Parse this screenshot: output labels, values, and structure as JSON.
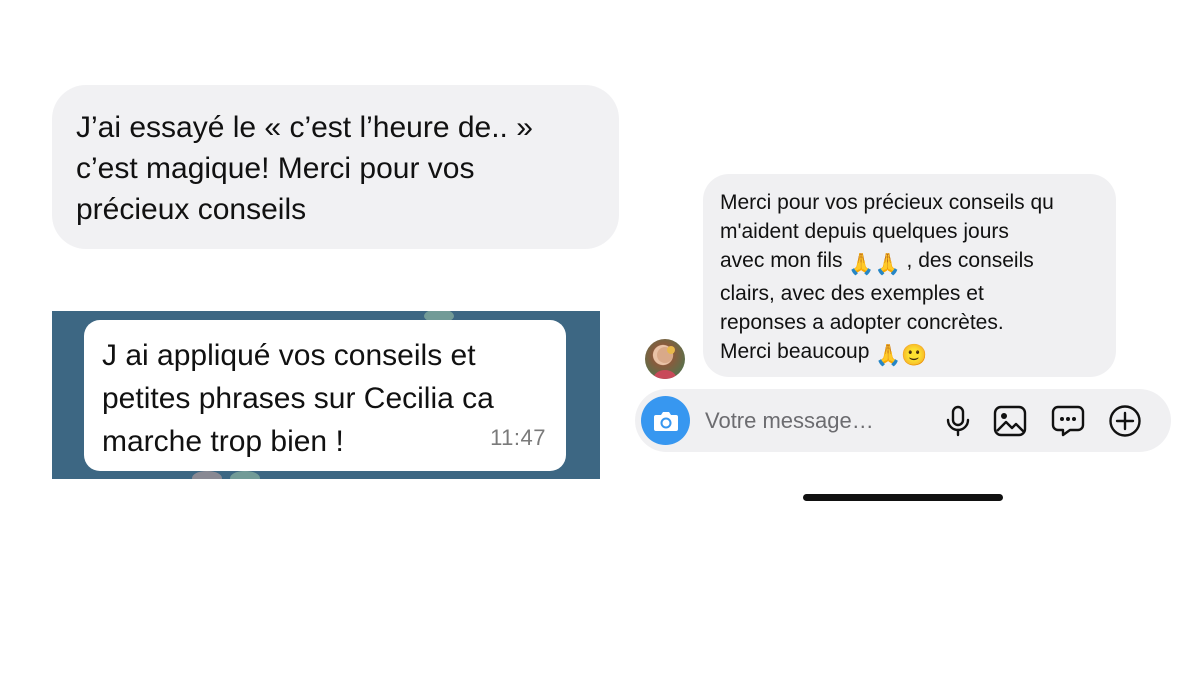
{
  "message_one": {
    "lines": [
      "J’ai essayé le « c’est l’heure de.. »",
      "c’est magique! Merci pour vos",
      "précieux conseils"
    ]
  },
  "message_two": {
    "lines": [
      "J ai appliqué vos conseils et",
      "petites phrases sur Cecilia ca",
      "marche trop bien !"
    ],
    "time": "11:47"
  },
  "message_three": {
    "line1": "Merci pour vos précieux conseils qu",
    "line2": "m'aident depuis quelques jours",
    "line3_text": "avec mon fils",
    "line3_emoji": "🙏🙏",
    "line3_tail": " , des conseils",
    "line4": "clairs, avec des exemples et",
    "line5": "reponses a adopter concrètes.",
    "line6_text": "Merci beaucoup",
    "line6_emoji": "🙏🙂"
  },
  "composer": {
    "placeholder": "Votre message…",
    "icons": [
      "camera-icon",
      "microphone-icon",
      "image-icon",
      "sticker-chat-icon",
      "plus-circle-icon"
    ],
    "accent_color": "#3797f0"
  },
  "colors": {
    "bubble_grey": "#f1f1f3",
    "whatsapp_bg": "#3d6783",
    "timestamp": "#7a7a7a"
  }
}
